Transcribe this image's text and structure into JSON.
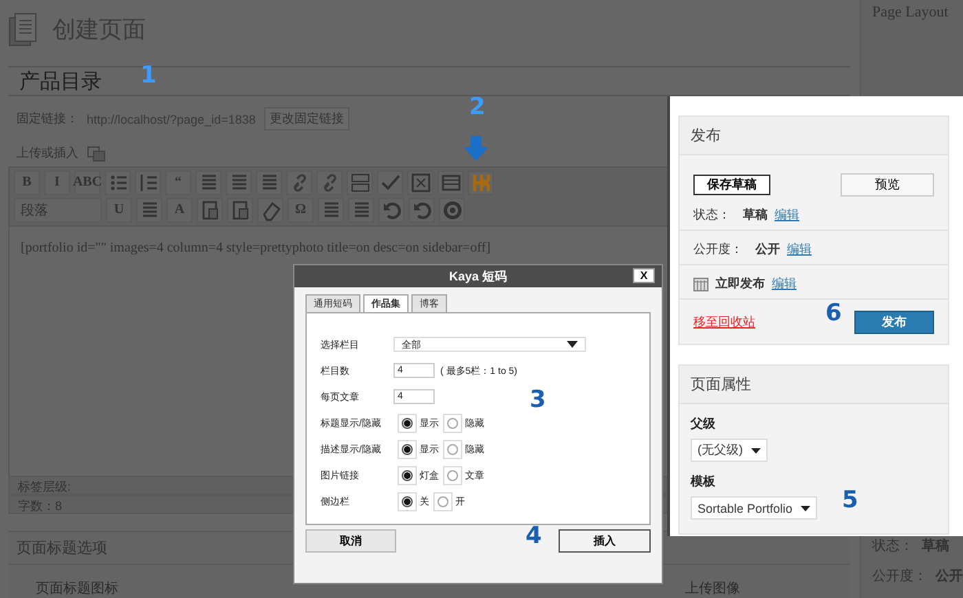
{
  "page": {
    "title": "创建页面"
  },
  "post_title": {
    "value": "产品目录"
  },
  "permalink": {
    "label": "固定链接：",
    "url": "http://localhost/?page_id=1838",
    "button": "更改固定链接"
  },
  "upload": {
    "label": "上传或插入"
  },
  "toolbar": {
    "rows": [
      [
        {
          "kind": "glyph",
          "label": "B"
        },
        {
          "kind": "glyph",
          "label": "I"
        },
        {
          "kind": "glyph",
          "label": "ABC"
        },
        {
          "kind": "bullets"
        },
        {
          "kind": "numbers"
        },
        {
          "kind": "glyph",
          "label": "“"
        },
        {
          "kind": "lines"
        },
        {
          "kind": "lines"
        },
        {
          "kind": "lines"
        },
        {
          "kind": "link"
        },
        {
          "kind": "link"
        },
        {
          "kind": "more"
        },
        {
          "kind": "spell"
        },
        {
          "kind": "frame"
        },
        {
          "kind": "grid"
        },
        {
          "kind": "brand"
        }
      ],
      [
        {
          "kind": "select",
          "label": "段落"
        },
        {
          "kind": "glyph",
          "label": "U"
        },
        {
          "kind": "lines"
        },
        {
          "kind": "glyph",
          "label": "A"
        },
        {
          "kind": "paste"
        },
        {
          "kind": "paste"
        },
        {
          "kind": "eraser"
        },
        {
          "kind": "glyph",
          "label": "Ω"
        },
        {
          "kind": "lines"
        },
        {
          "kind": "lines"
        },
        {
          "kind": "undo"
        },
        {
          "kind": "undo"
        },
        {
          "kind": "help"
        }
      ]
    ]
  },
  "editor": {
    "content": "[portfolio id=\"\" images=4 column=4 style=prettyphoto title=on desc=on sidebar=off]"
  },
  "status_bar": {
    "path": "标签层级:",
    "word_count": "字数：8"
  },
  "title_options": {
    "heading": "页面标题选项",
    "field_label": "页面标题图标",
    "upload_label": "上传图像"
  },
  "side_background": {
    "heading": "Page Layout",
    "rows": [
      {
        "label": "状态：",
        "value": "草稿"
      },
      {
        "label": "公开度：",
        "value": "公开"
      }
    ]
  },
  "dialog": {
    "title": "Kaya 短码",
    "close": "X",
    "tabs": [
      {
        "label": "通用短码",
        "selected": false
      },
      {
        "label": "作品集",
        "selected": true
      },
      {
        "label": "博客",
        "selected": false
      }
    ],
    "fields": [
      {
        "kind": "select",
        "label": "选择栏目",
        "value": "全部"
      },
      {
        "kind": "text",
        "label": "栏目数",
        "value": "4",
        "hint": "( 最多5栏：1 to 5)"
      },
      {
        "kind": "text",
        "label": "每页文章",
        "value": "4"
      },
      {
        "kind": "radio",
        "label": "标题显示/隐藏",
        "options": [
          {
            "label": "显示",
            "selected": true
          },
          {
            "label": "隐藏",
            "selected": false
          }
        ]
      },
      {
        "kind": "radio",
        "label": "描述显示/隐藏",
        "options": [
          {
            "label": "显示",
            "selected": true
          },
          {
            "label": "隐藏",
            "selected": false
          }
        ]
      },
      {
        "kind": "radio",
        "label": "图片链接",
        "options": [
          {
            "label": "灯盒",
            "selected": true
          },
          {
            "label": "文章",
            "selected": false
          }
        ]
      },
      {
        "kind": "radio",
        "label": "侧边栏",
        "options": [
          {
            "label": "关",
            "selected": true
          },
          {
            "label": "开",
            "selected": false
          }
        ]
      }
    ],
    "cancel": "取消",
    "insert": "插入"
  },
  "publish": {
    "heading": "发布",
    "save_draft": "保存草稿",
    "preview": "预览",
    "rows": [
      {
        "kind": "text",
        "label": "状态：",
        "value": "草稿",
        "link": "编辑"
      },
      {
        "kind": "text",
        "label": "公开度：",
        "value": "公开",
        "link": "编辑"
      },
      {
        "kind": "calendar",
        "value": "立即发布",
        "link": "编辑"
      }
    ],
    "trash": "移至回收站",
    "publish": "发布"
  },
  "page_attributes": {
    "heading": "页面属性",
    "parent_label": "父级",
    "parent": "(无父级)",
    "template_label": "模板",
    "template": "Sortable Portfolio"
  },
  "annotations": [
    "1",
    "2",
    "3",
    "4",
    "5",
    "6"
  ]
}
